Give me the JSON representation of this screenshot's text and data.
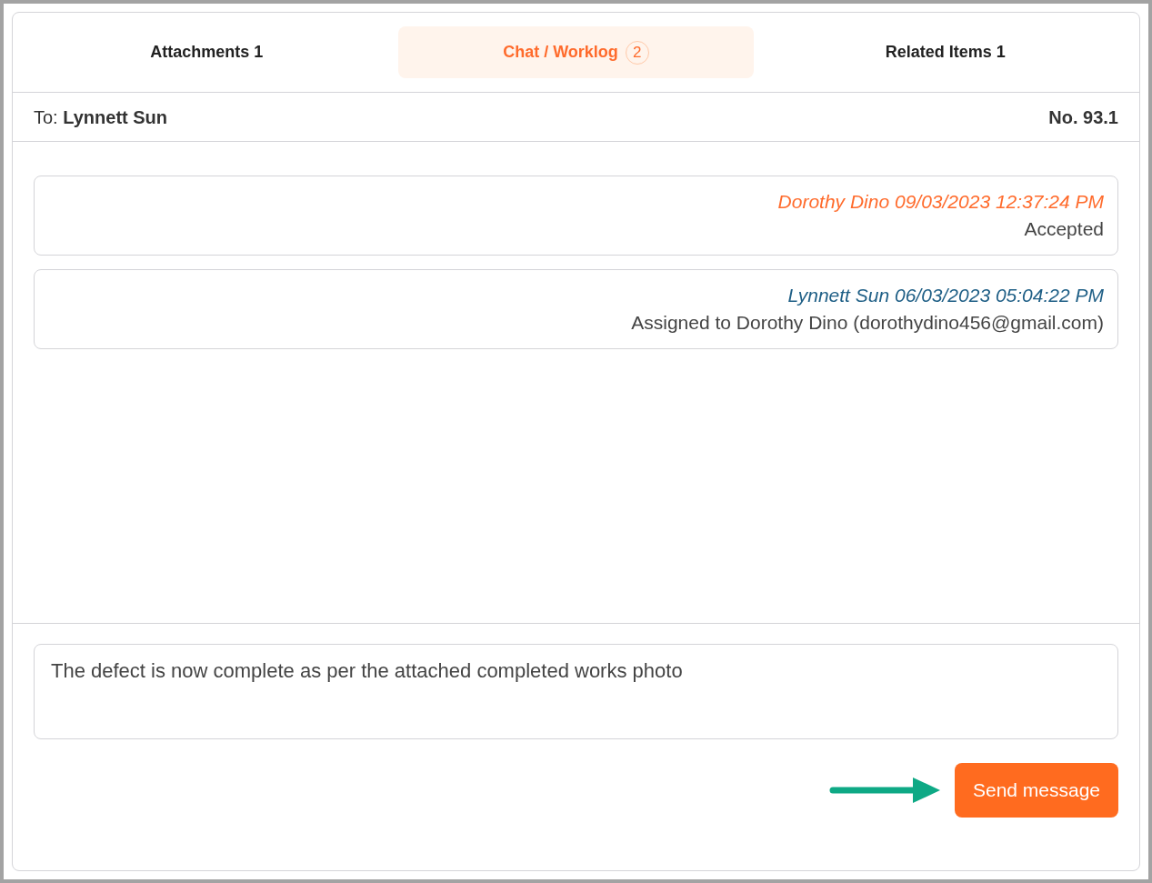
{
  "tabs": [
    {
      "label": "Attachments 1",
      "selected": false
    },
    {
      "label": "Chat / Worklog",
      "count": "2",
      "selected": true
    },
    {
      "label": "Related Items 1",
      "selected": false
    }
  ],
  "header": {
    "to_label": "To:",
    "to_name": "Lynnett Sun",
    "number": "No. 93.1"
  },
  "messages": [
    {
      "meta": "Dorothy Dino 09/03/2023 12:37:24 PM",
      "color": "#ff6b2c",
      "body": "Accepted"
    },
    {
      "meta": "Lynnett Sun 06/03/2023 05:04:22 PM",
      "color": "#1f5f86",
      "body": "Assigned to Dorothy Dino (dorothydino456@gmail.com)"
    }
  ],
  "composer": {
    "value": "The defect is now complete as per the attached completed works photo"
  },
  "send_button": "Send message"
}
